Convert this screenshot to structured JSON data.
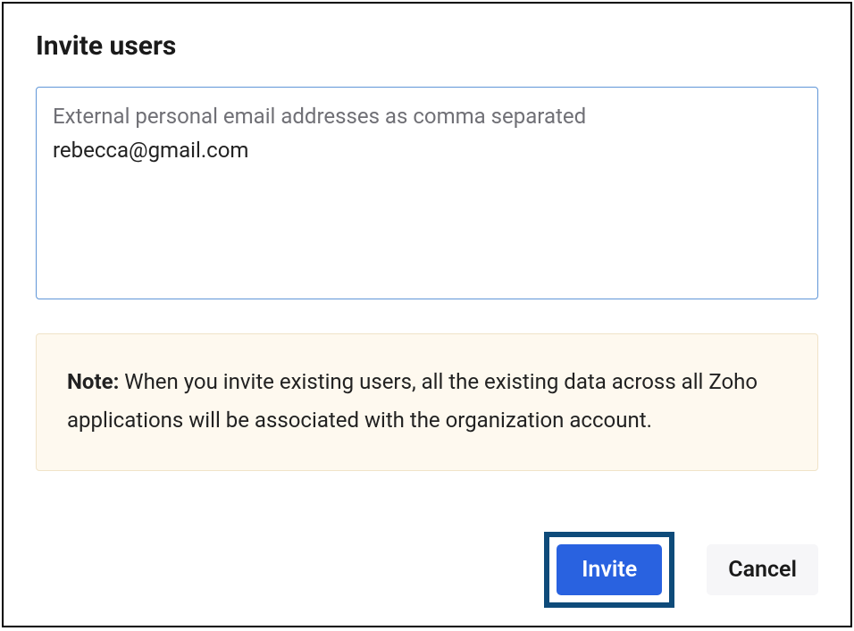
{
  "dialog": {
    "title": "Invite users",
    "emailInput": {
      "label": "External personal email addresses as comma separated",
      "value": "rebecca@gmail.com"
    },
    "note": {
      "label": "Note:",
      "text": " When you invite existing users, all the existing data across all Zoho applications will be associated with the organization account."
    },
    "buttons": {
      "invite": "Invite",
      "cancel": "Cancel"
    }
  },
  "colors": {
    "primary": "#2962e0",
    "highlightBorder": "#0e4b7a",
    "noteBackground": "#fef9ef",
    "inputBorder": "#6096d8"
  }
}
